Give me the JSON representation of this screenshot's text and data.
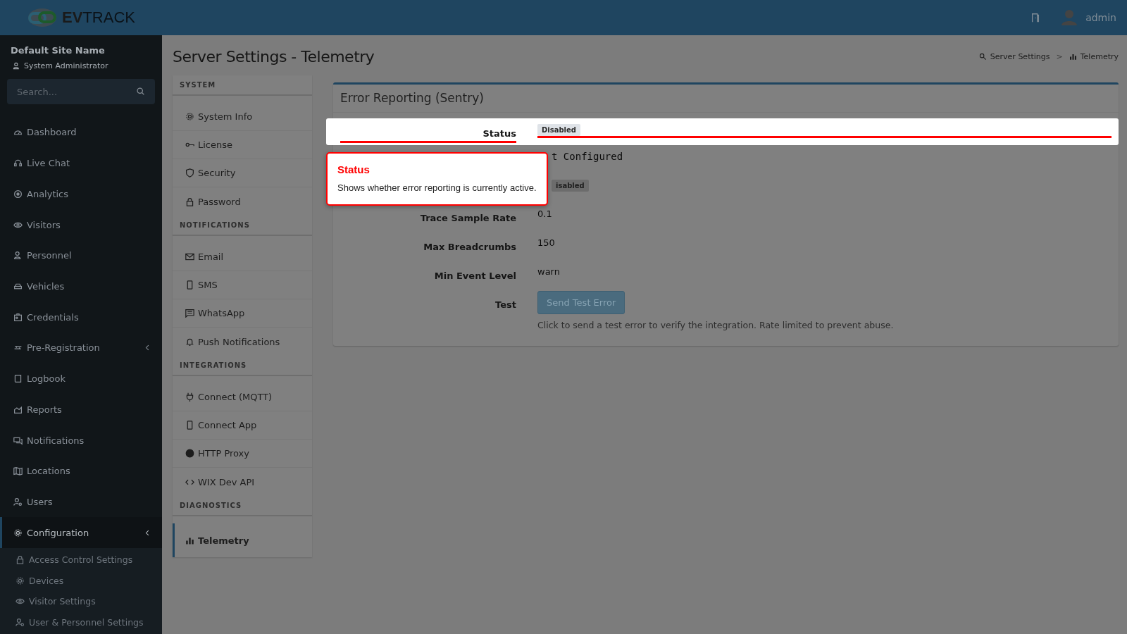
{
  "brand": {
    "bold": "EV",
    "light": "TRACK"
  },
  "topbar": {
    "user": "admin"
  },
  "site": {
    "name": "Default Site Name",
    "role": "System Administrator"
  },
  "search": {
    "placeholder": "Search..."
  },
  "nav": [
    {
      "label": "Dashboard",
      "selected": false
    },
    {
      "label": "Live Chat",
      "selected": false
    },
    {
      "label": "Analytics",
      "selected": false
    },
    {
      "label": "Visitors",
      "selected": false
    },
    {
      "label": "Personnel",
      "selected": false
    },
    {
      "label": "Vehicles",
      "selected": false
    },
    {
      "label": "Credentials",
      "selected": false
    },
    {
      "label": "Pre-Registration",
      "selected": false,
      "expandable": true
    },
    {
      "label": "Logbook",
      "selected": false
    },
    {
      "label": "Reports",
      "selected": false
    },
    {
      "label": "Notifications",
      "selected": false
    },
    {
      "label": "Locations",
      "selected": false
    },
    {
      "label": "Users",
      "selected": false
    },
    {
      "label": "Configuration",
      "selected": true,
      "expandable": true,
      "children": [
        {
          "label": "Access Control Settings"
        },
        {
          "label": "Devices"
        },
        {
          "label": "Visitor Settings"
        },
        {
          "label": "User & Personnel Settings"
        }
      ]
    }
  ],
  "page": {
    "title": "Server Settings - Telemetry",
    "breadcrumb": [
      "Server Settings",
      "Telemetry"
    ],
    "separator": ">"
  },
  "settings_nav": [
    {
      "title": "SYSTEM",
      "items": [
        {
          "label": "System Info",
          "selected": false
        },
        {
          "label": "License",
          "selected": false
        },
        {
          "label": "Security",
          "selected": false
        },
        {
          "label": "Password",
          "selected": false
        }
      ]
    },
    {
      "title": "NOTIFICATIONS",
      "items": [
        {
          "label": "Email",
          "selected": false
        },
        {
          "label": "SMS",
          "selected": false
        },
        {
          "label": "WhatsApp",
          "selected": false
        },
        {
          "label": "Push Notifications",
          "selected": false
        }
      ]
    },
    {
      "title": "INTEGRATIONS",
      "items": [
        {
          "label": "Connect (MQTT)",
          "selected": false
        },
        {
          "label": "Connect App",
          "selected": false
        },
        {
          "label": "HTTP Proxy",
          "selected": false
        },
        {
          "label": "WIX Dev API",
          "selected": false
        }
      ]
    },
    {
      "title": "DIAGNOSTICS",
      "items": [
        {
          "label": "Telemetry",
          "selected": true
        }
      ]
    }
  ],
  "card": {
    "title": "Error Reporting (Sentry)",
    "rows": [
      {
        "kind": "badge",
        "label": "Status",
        "value": "Disabled",
        "highlighted": true
      },
      {
        "kind": "mono",
        "value": "t Configured"
      },
      {
        "kind": "badge",
        "value": "isabled"
      },
      {
        "kind": "text",
        "label": "Trace Sample Rate",
        "value": "0.1"
      },
      {
        "kind": "text",
        "label": "Max Breadcrumbs",
        "value": "150"
      },
      {
        "kind": "text",
        "label": "Min Event Level",
        "value": "warn"
      },
      {
        "kind": "button",
        "label": "Test",
        "value": "Send Test Error",
        "help": "Click to send a test error to verify the integration. Rate limited to prevent abuse."
      }
    ]
  },
  "tooltip": {
    "title": "Status",
    "text": "Shows whether error reporting is currently active."
  }
}
